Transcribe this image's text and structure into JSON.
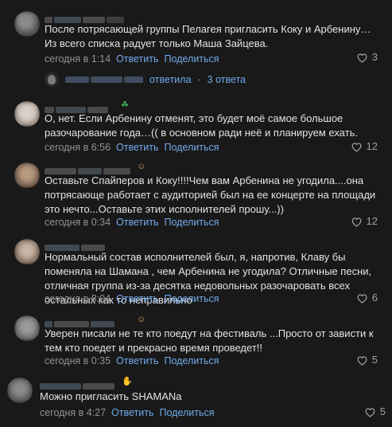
{
  "comments": [
    {
      "text": "После потрясающей группы Пелагея пригласить Коку и Арбенину… Из всего списка радует только Маша Зайцева.",
      "time": "сегодня в 1:14",
      "reply": "Ответить",
      "share": "Поделиться",
      "likes": "3",
      "thread": {
        "verb": "ответила",
        "sep": "·",
        "count": "3 ответа"
      }
    },
    {
      "text": "О, нет. Если Арбенину отменят, это будет моё самое большое разочарование года…(( в основном ради неё и планируем ехать.",
      "time": "сегодня в 6:56",
      "reply": "Ответить",
      "share": "Поделиться",
      "likes": "12"
    },
    {
      "text": "Оставьте Спайперов и Коку!!!!Чем вам Арбенина не угодила....она потрясающе работает с аудиторией был на ее концерте на площади это нечто...Оставьте этих исполнителей прошу...))",
      "time": "сегодня в 0:34",
      "reply": "Ответить",
      "share": "Поделиться",
      "likes": "12"
    },
    {
      "text": "Нормальный состав исполнителей был, я, напротив, Клаву бы поменяла на Шамана , чем Арбенина не угодила? Отличные песни, отличная группа из-за десятка недовольных разочаровать всех остальных как то неправильно",
      "time": "сегодня в 8:04",
      "reply": "Ответить",
      "share": "Поделиться",
      "likes": "6"
    },
    {
      "text": "Уверен писали не те кто поедут на фестиваль ...Просто от зависти к тем кто поедет и прекрасно время проведет!!",
      "time": "сегодня в 0:35",
      "reply": "Ответить",
      "share": "Поделиться",
      "likes": "5"
    },
    {
      "text": "Можно пригласить SHAMANа",
      "time": "сегодня в 4:27",
      "reply": "Ответить",
      "share": "Поделиться",
      "likes": "5"
    }
  ],
  "colors": {
    "background": "#191919",
    "text": "#e1e3e6",
    "secondary": "#939393",
    "accent": "#71aaeb"
  },
  "icons": {
    "like": "heart-outline-icon"
  }
}
